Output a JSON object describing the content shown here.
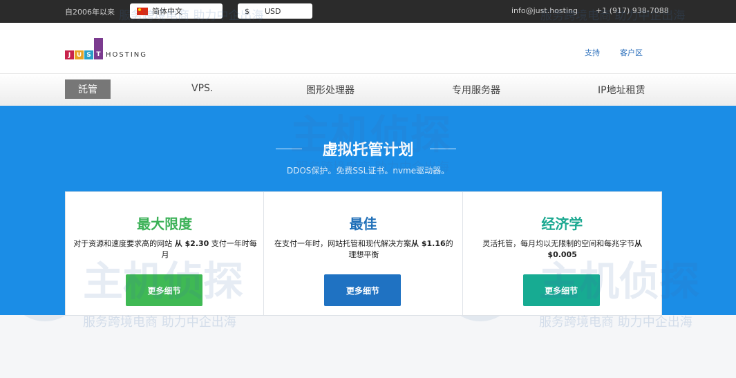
{
  "topbar": {
    "since": "自2006年以来",
    "language": "简体中文",
    "currency_symbol": "$",
    "currency": "USD",
    "email": "info@just.hosting",
    "phone": "+1 (917) 938-7088"
  },
  "header": {
    "logo_letters": [
      "J",
      "U",
      "S",
      "T"
    ],
    "logo_word": "HOSTING",
    "support": "支持",
    "client_area": "客户区"
  },
  "nav": {
    "active": "託管",
    "items": [
      "VPS.",
      "图形处理器",
      "专用服务器",
      "IP地址租赁"
    ]
  },
  "hero": {
    "title": "虚拟托管计划",
    "subtitle": "DDOS保护。免费SSL证书。nvme驱动器。"
  },
  "plans": [
    {
      "title": "最大限度",
      "desc_before": "对于资源和速度要求高的网站 ",
      "price": "从 $2.30",
      "desc_after": " 支付一年时每月",
      "button": "更多细节",
      "color": "#3fb954"
    },
    {
      "title": "最佳",
      "desc_before": "在支付一年时，网站托管和现代解决方案",
      "price": "从 $1.16",
      "desc_after": "的理想平衡",
      "button": "更多细节",
      "color": "#1f72c2"
    },
    {
      "title": "经济学",
      "desc_before": "灵活托管，每月均以无限制的空间和每兆字节",
      "price": "从 $0.005",
      "desc_after": "",
      "button": "更多细节",
      "color": "#17ab92"
    }
  ],
  "watermark": {
    "big": "主机侦探",
    "small": "服务跨境电商 助力中企出海"
  }
}
